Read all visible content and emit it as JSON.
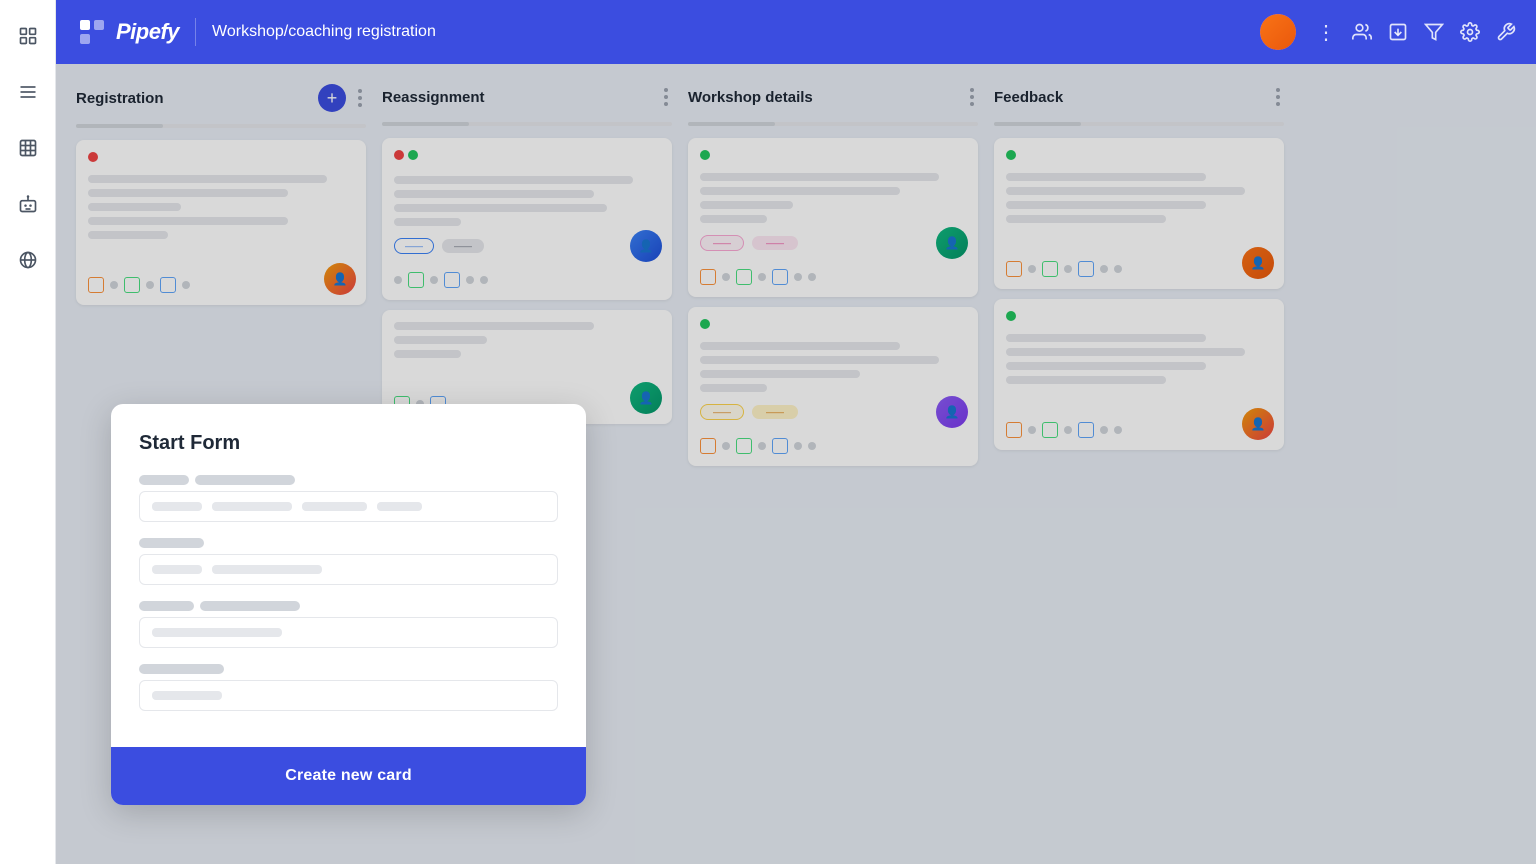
{
  "app": {
    "name": "Pipefy",
    "title": "Workshop/coaching registration"
  },
  "header": {
    "title": "Workshop/coaching registration",
    "logo": "pipefy",
    "actions": [
      "members",
      "import",
      "filter",
      "settings",
      "wrench",
      "more"
    ]
  },
  "sidebar": {
    "items": [
      {
        "name": "grid-view",
        "icon": "grid"
      },
      {
        "name": "list-view",
        "icon": "list"
      },
      {
        "name": "table-view",
        "icon": "table"
      },
      {
        "name": "bot-view",
        "icon": "bot"
      },
      {
        "name": "globe-view",
        "icon": "globe"
      }
    ]
  },
  "columns": [
    {
      "id": "registration",
      "title": "Registration",
      "hasAddButton": true,
      "cards": [
        {
          "id": "card-1",
          "dotColor": "red",
          "lines": [
            3,
            2,
            2,
            2,
            1
          ],
          "avatar": "face-1",
          "footer": {
            "hasOrangeIcon": true,
            "hasGreenIcon": true,
            "hasBlueIcon": true,
            "dotCount": 3
          }
        },
        {
          "id": "card-2",
          "dotColor": "none",
          "lines": [
            2,
            2,
            1
          ],
          "avatar": "face-2",
          "footer": {}
        }
      ]
    },
    {
      "id": "reassignment",
      "title": "Reassignment",
      "hasAddButton": false,
      "cards": [
        {
          "id": "card-3",
          "dotColor": "red-green",
          "lines": [
            3,
            2,
            2,
            1
          ],
          "badges": [
            "outline",
            "filled"
          ],
          "avatar": "face-2",
          "footer": {
            "hasGreenIcon": true,
            "hasBlueIcon": true,
            "dotCount": 2
          }
        },
        {
          "id": "card-4",
          "dotColor": "none",
          "lines": [
            2,
            1,
            1
          ],
          "avatar": "face-3",
          "footer": {
            "hasGreenIcon": true,
            "hasBlueIcon": true,
            "dotCount": 0
          }
        }
      ]
    },
    {
      "id": "workshop-details",
      "title": "Workshop details",
      "hasAddButton": false,
      "cards": [
        {
          "id": "card-5",
          "dotColor": "green",
          "lines": [
            3,
            2,
            1,
            1,
            1
          ],
          "badges": [
            "pink-outline",
            "pink-filled"
          ],
          "avatar": "face-3",
          "footer": {
            "hasOrangeIcon": true,
            "hasGreenIcon": true,
            "hasBlueIcon": true,
            "dotCount": 2
          }
        },
        {
          "id": "card-6",
          "dotColor": "green",
          "lines": [
            2,
            2,
            1,
            1,
            1
          ],
          "badges": [
            "yellow-outline",
            "yellow-filled"
          ],
          "avatar": "face-4",
          "footer": {
            "hasOrangeIcon": true,
            "hasGreenIcon": true,
            "hasBlueIcon": true,
            "dotCount": 2
          }
        }
      ]
    },
    {
      "id": "feedback",
      "title": "Feedback",
      "hasAddButton": false,
      "cards": [
        {
          "id": "card-7",
          "dotColor": "green",
          "lines": [
            2,
            2,
            2,
            1,
            1
          ],
          "avatar": "face-5",
          "footer": {
            "hasOrangeIcon": true,
            "hasGreenIcon": true,
            "hasBlueIcon": true,
            "dotCount": 2
          }
        },
        {
          "id": "card-8",
          "dotColor": "green",
          "lines": [
            2,
            2,
            2,
            1,
            1
          ],
          "avatar": "face-1",
          "footer": {
            "hasOrangeIcon": true,
            "hasGreenIcon": true,
            "hasBlueIcon": true,
            "dotCount": 2
          }
        }
      ]
    }
  ],
  "modal": {
    "title": "Start Form",
    "fields": [
      {
        "label_bars": [
          50,
          100
        ],
        "input_bars": [
          50,
          80,
          65,
          45
        ]
      },
      {
        "label_bars": [
          65
        ],
        "input_bars": [
          50,
          110
        ]
      },
      {
        "label_bars": [
          55,
          100
        ],
        "input_bars": [
          130
        ]
      },
      {
        "label_bars": [
          85
        ],
        "input_bars": [
          70
        ]
      }
    ],
    "create_button": "Create new card"
  }
}
